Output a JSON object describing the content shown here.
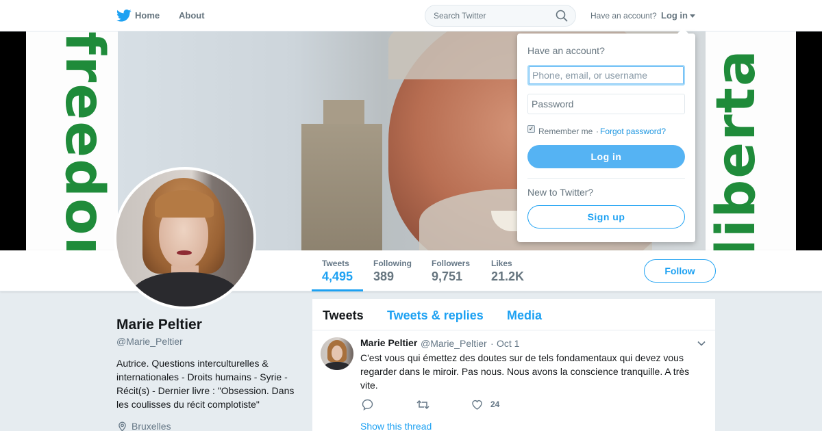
{
  "nav": {
    "home_label": "Home",
    "about_label": "About",
    "search_placeholder": "Search Twitter",
    "have_account": "Have an account?",
    "login_label": "Log in",
    "brand_color": "#1da1f2"
  },
  "banner": {
    "left_text": "freedom",
    "right_text": "liberta"
  },
  "login_dropdown": {
    "title": "Have an account?",
    "username_placeholder": "Phone, email, or username",
    "password_placeholder": "Password",
    "remember_me": "Remember me",
    "separator": "·",
    "forgot_password": "Forgot password?",
    "login_button": "Log in",
    "new_to_twitter": "New to Twitter?",
    "signup_button": "Sign up"
  },
  "stats": {
    "tweets": {
      "label": "Tweets",
      "value": "4,495"
    },
    "following": {
      "label": "Following",
      "value": "389"
    },
    "followers": {
      "label": "Followers",
      "value": "9,751"
    },
    "likes": {
      "label": "Likes",
      "value": "21.2K"
    }
  },
  "follow_button": "Follow",
  "profile": {
    "name": "Marie Peltier",
    "handle": "@Marie_Peltier",
    "bio": "Autrice. Questions interculturelles & internationales - Droits humains - Syrie - Récit(s) - Dernier livre : \"Obsession. Dans les coulisses du récit complotiste\"",
    "location": "Bruxelles"
  },
  "timeline": {
    "tabs": [
      {
        "label": "Tweets"
      },
      {
        "label": "Tweets & replies"
      },
      {
        "label": "Media"
      }
    ],
    "tweets": [
      {
        "name": "Marie Peltier",
        "handle": "@Marie_Peltier",
        "separator": "·",
        "date": "Oct 1",
        "text": "C'est vous qui émettez des doutes sur de tels fondamentaux qui devez vous regarder dans le miroir. Pas nous. Nous avons la conscience tranquille. A très vite.",
        "like_count": "24",
        "show_thread": "Show this thread"
      }
    ]
  }
}
